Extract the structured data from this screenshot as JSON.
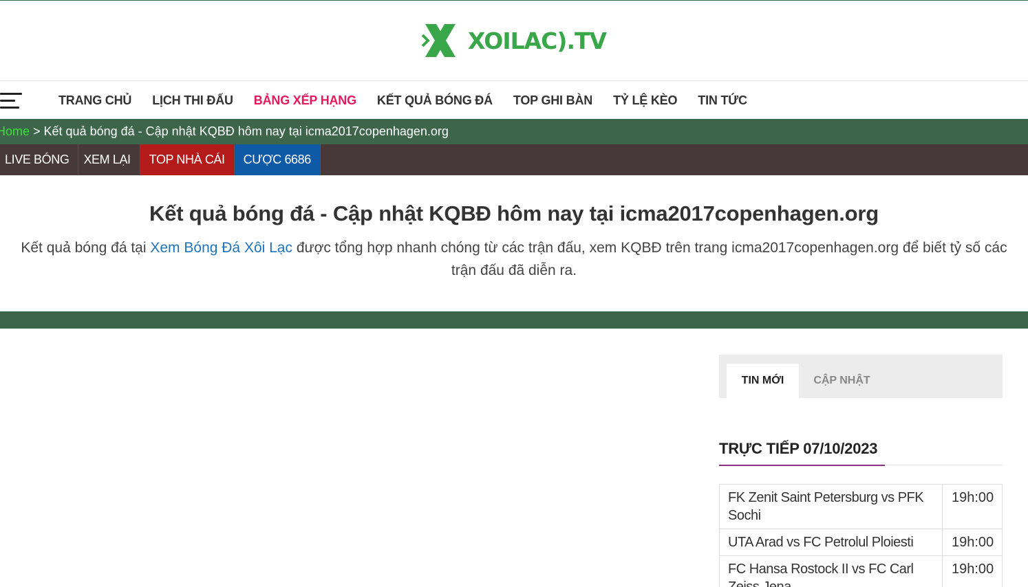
{
  "header": {
    "logo_text": "XOILAC).TV"
  },
  "nav": {
    "items": [
      {
        "label": "TRANG CHỦ"
      },
      {
        "label": "LỊCH THI ĐẤU"
      },
      {
        "label": "BẢNG XẾP HẠNG",
        "active": true
      },
      {
        "label": "KẾT QUẢ BÓNG ĐÁ"
      },
      {
        "label": "TOP GHI BÀN"
      },
      {
        "label": "TỶ LỆ KÈO"
      },
      {
        "label": "TIN TỨC"
      }
    ],
    "active_color": "#e6195a"
  },
  "breadcrumb": {
    "home": "Home",
    "separator": " > ",
    "current": "Kết quả bóng đá - Cập nhật KQBĐ hôm nay tại icma2017copenhagen.org"
  },
  "subnav": {
    "items": [
      {
        "label": "LIVE BÓNG"
      },
      {
        "label": "XEM LẠI"
      },
      {
        "label": "TOP NHÀ CÁI",
        "color": "#b51a1a"
      },
      {
        "label": "CƯỢC 6686",
        "color": "#0e5aa6"
      }
    ]
  },
  "main": {
    "title": "Kết quả bóng đá - Cập nhật KQBĐ hôm nay tại icma2017copenhagen.org",
    "intro_before": "Kết quả bóng đá tại ",
    "intro_link": "Xem Bóng Đá Xôi Lạc",
    "intro_after": " được tổng hợp nhanh chóng từ các trận đấu, xem KQBĐ trên trang icma2017copenhagen.org để biết tỷ số các trận đấu đã diễn ra."
  },
  "sidebar": {
    "tabs": [
      {
        "label": "TIN MỚI",
        "active": true
      },
      {
        "label": "CẬP NHẬT",
        "active": false
      }
    ],
    "section_title": "TRỰC TIẾP 07/10/2023",
    "matches": [
      {
        "teams": "FK Zenit Saint Petersburg vs PFK Sochi",
        "time": "19h:00"
      },
      {
        "teams": "UTA Arad vs FC Petrolul Ploiesti",
        "time": "19h:00"
      },
      {
        "teams": "FC Hansa Rostock II vs FC Carl Zeiss Jena",
        "time": "19h:00"
      }
    ]
  },
  "colors": {
    "brand_green": "#3aa64a",
    "bar_green": "#3c654a",
    "subnav_bg": "#473939"
  }
}
